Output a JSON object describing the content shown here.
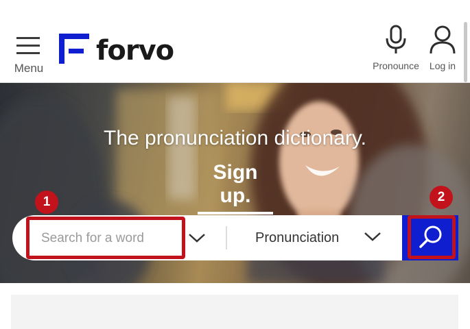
{
  "header": {
    "menu_label": "Menu",
    "logo_text": "forvo",
    "pronounce_label": "Pronounce",
    "login_label": "Log in"
  },
  "hero": {
    "tagline": "The pronunciation dictionary.",
    "signup_label": "Sign up."
  },
  "search": {
    "placeholder": "Search for a word",
    "type_value": "Pronunciation"
  },
  "annotations": [
    {
      "number": "1"
    },
    {
      "number": "2"
    }
  ],
  "colors": {
    "brand_blue": "#0f1fcf",
    "annotation_red": "#c2121c"
  },
  "icons": [
    "menu-icon",
    "forvo-logo-icon",
    "microphone-icon",
    "user-icon",
    "chevron-down-icon",
    "search-icon"
  ]
}
